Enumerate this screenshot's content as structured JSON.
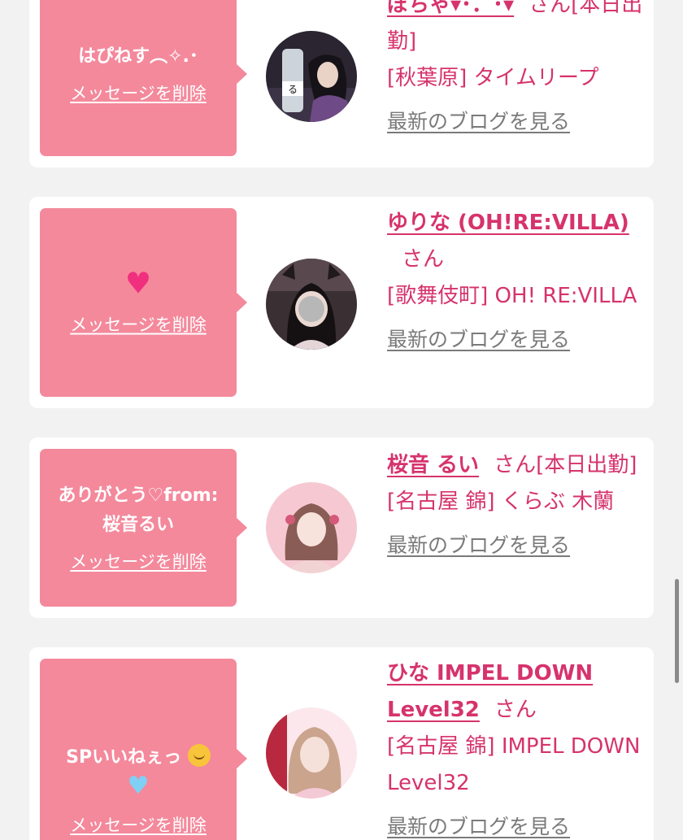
{
  "colors": {
    "background": "#f2f2f2",
    "card": "#ffffff",
    "bubble": "#f4899c",
    "accent": "#d6336c",
    "link_gray": "#7a7a7a"
  },
  "cards": [
    {
      "message": "はぴねす︵✧.･",
      "delete_label": "メッセージを削除",
      "name": "ぽちゃ▾･．･▾",
      "san": "さん",
      "shift_status": "[本日出勤]",
      "shop": "[秋葉原] タイムリープ",
      "blog_label": "最新のブログを見る"
    },
    {
      "message_icon": "pink-heart-icon",
      "message_glyph": "♥",
      "delete_label": "メッセージを削除",
      "name": "ゆりな (OH!RE:VILLA)",
      "san": "さん",
      "shop": "[歌舞伎町] OH! RE:VILLA",
      "blog_label": "最新のブログを見る"
    },
    {
      "message": "ありがとう♡from: 桜音るい",
      "delete_label": "メッセージを削除",
      "name": "桜音 るい",
      "san": "さん",
      "shift_status": "[本日出勤]",
      "shop": "[名古屋 錦] くらぶ 木蘭",
      "blog_label": "最新のブログを見る"
    },
    {
      "message": "SPいいねぇっ",
      "message_icon": "smiling-face-icon",
      "message_icon_2": "blue-heart-icon",
      "message_glyph_2": "♥",
      "delete_label": "メッセージを削除",
      "name": "ひな IMPEL DOWN Level32",
      "san": "さん",
      "shop": "[名古屋 錦] IMPEL DOWN Level32",
      "blog_label": "最新のブログを見る"
    }
  ]
}
